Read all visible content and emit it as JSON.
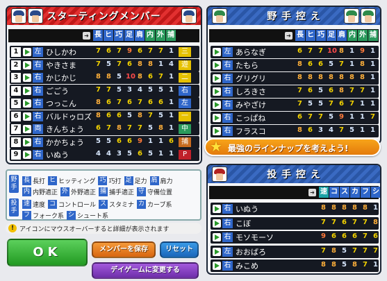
{
  "starting": {
    "title": "スターティングメンバー",
    "headers": [
      "長",
      "ヒ",
      "巧",
      "足",
      "肩",
      "内",
      "外",
      "捕"
    ],
    "rows": [
      {
        "num": "1",
        "hand": "左",
        "name": "ひしかわ",
        "vals": [
          "7",
          "6",
          "7",
          "9",
          "6",
          "7",
          "7",
          "1"
        ],
        "pos": "三",
        "pos_color": "#e6c100"
      },
      {
        "num": "2",
        "hand": "右",
        "name": "やきさま",
        "vals": [
          "7",
          "5",
          "7",
          "6",
          "8",
          "8",
          "1",
          "4"
        ],
        "pos": "遊",
        "pos_color": "#e6c100"
      },
      {
        "num": "3",
        "hand": "右",
        "name": "かじかじ",
        "vals": [
          "8",
          "8",
          "5",
          "10",
          "8",
          "6",
          "7",
          "1"
        ],
        "pos": "二",
        "pos_color": "#e6c100"
      },
      {
        "num": "4",
        "hand": "右",
        "name": "ごごう",
        "vals": [
          "7",
          "7",
          "5",
          "3",
          "4",
          "5",
          "5",
          "1"
        ],
        "pos": "右",
        "pos_color": "#2f66c9"
      },
      {
        "num": "5",
        "hand": "右",
        "name": "つっこん",
        "vals": [
          "8",
          "6",
          "7",
          "6",
          "7",
          "6",
          "6",
          "1"
        ],
        "pos": "左",
        "pos_color": "#2f66c9"
      },
      {
        "num": "6",
        "hand": "右",
        "name": "バルドゥロズ",
        "vals": [
          "8",
          "6",
          "6",
          "5",
          "8",
          "7",
          "5",
          "1"
        ],
        "pos": "一",
        "pos_color": "#e6c100"
      },
      {
        "num": "7",
        "hand": "両",
        "name": "きんちょう",
        "vals": [
          "6",
          "7",
          "8",
          "7",
          "7",
          "5",
          "8",
          "1"
        ],
        "pos": "中",
        "pos_color": "#2a9a5c"
      },
      {
        "num": "8",
        "hand": "右",
        "name": "かかちょう",
        "vals": [
          "5",
          "5",
          "6",
          "6",
          "9",
          "1",
          "1",
          "6"
        ],
        "pos": "捕",
        "pos_color": "#c76a1e"
      },
      {
        "num": "9",
        "hand": "右",
        "name": "いぬう",
        "vals": [
          "4",
          "4",
          "3",
          "5",
          "6",
          "5",
          "1",
          "1"
        ],
        "pos": "P",
        "pos_color": "#c0202a"
      }
    ]
  },
  "bench": {
    "title": "野 手 控 え",
    "headers": [
      "長",
      "ヒ",
      "巧",
      "足",
      "肩",
      "内",
      "外",
      "捕"
    ],
    "rows": [
      {
        "hand": "左",
        "name": "あらなぎ",
        "vals": [
          "6",
          "7",
          "7",
          "10",
          "8",
          "1",
          "9",
          "1"
        ]
      },
      {
        "hand": "右",
        "name": "たもら",
        "vals": [
          "8",
          "6",
          "6",
          "5",
          "7",
          "1",
          "8",
          "1"
        ]
      },
      {
        "hand": "右",
        "name": "グリグリ",
        "vals": [
          "8",
          "8",
          "8",
          "8",
          "8",
          "8",
          "8",
          "1"
        ]
      },
      {
        "hand": "右",
        "name": "しろきさ",
        "vals": [
          "7",
          "6",
          "5",
          "6",
          "8",
          "7",
          "7",
          "1"
        ]
      },
      {
        "hand": "右",
        "name": "みやざけ",
        "vals": [
          "7",
          "5",
          "5",
          "7",
          "6",
          "7",
          "1",
          "1"
        ]
      },
      {
        "hand": "右",
        "name": "こっぱね",
        "vals": [
          "6",
          "7",
          "7",
          "5",
          "9",
          "1",
          "1",
          "7"
        ]
      },
      {
        "hand": "右",
        "name": "フラスコ",
        "vals": [
          "8",
          "6",
          "3",
          "4",
          "7",
          "5",
          "1",
          "1"
        ]
      }
    ]
  },
  "banner": "最強のラインナップを考えよう!",
  "pitchers": {
    "title": "投 手 控 え",
    "headers": [
      "速",
      "コ",
      "ス",
      "カ",
      "フ",
      "シ"
    ],
    "rows": [
      {
        "hand": "右",
        "name": "いぬう",
        "vals": [
          "8",
          "8",
          "8",
          "8",
          "8",
          "1"
        ]
      },
      {
        "hand": "右",
        "name": "こぼ",
        "vals": [
          "7",
          "7",
          "6",
          "7",
          "7",
          "8"
        ]
      },
      {
        "hand": "右",
        "name": "モソモーソ",
        "vals": [
          "9",
          "6",
          "6",
          "6",
          "7",
          "6"
        ]
      },
      {
        "hand": "左",
        "name": "おおばろ",
        "vals": [
          "7",
          "8",
          "5",
          "7",
          "7",
          "7"
        ]
      },
      {
        "hand": "右",
        "name": "みこめ",
        "vals": [
          "8",
          "8",
          "5",
          "8",
          "7",
          "1"
        ]
      }
    ]
  },
  "legend": {
    "fielder_tag": "野手",
    "pitcher_tag": "投手",
    "fielder_items": [
      {
        "chip": "長",
        "text": "長打"
      },
      {
        "chip": "ヒ",
        "text": "ヒッティング"
      },
      {
        "chip": "巧",
        "text": "巧打"
      },
      {
        "chip": "足",
        "text": "足力"
      },
      {
        "chip": "肩",
        "text": "肩力"
      },
      {
        "chip": "内",
        "text": "内野適正"
      },
      {
        "chip": "外",
        "text": "外野適正"
      },
      {
        "chip": "捕",
        "text": "捕手適正"
      },
      {
        "chip": "守",
        "text": "守備位置"
      }
    ],
    "pitcher_items": [
      {
        "chip": "速",
        "text": "速度"
      },
      {
        "chip": "コ",
        "text": "コントロール"
      },
      {
        "chip": "ス",
        "text": "スタミナ"
      },
      {
        "chip": "カ",
        "text": "カーブ系"
      },
      {
        "chip": "フ",
        "text": "フォーク系"
      },
      {
        "chip": "シ",
        "text": "シュート系"
      }
    ]
  },
  "hint": "アイコンにマウスオーバーすると詳細が表示されます",
  "buttons": {
    "ok": "OK",
    "save": "メンバーを保存",
    "reset": "リセット",
    "dayGame": "デイゲームに変更する"
  }
}
